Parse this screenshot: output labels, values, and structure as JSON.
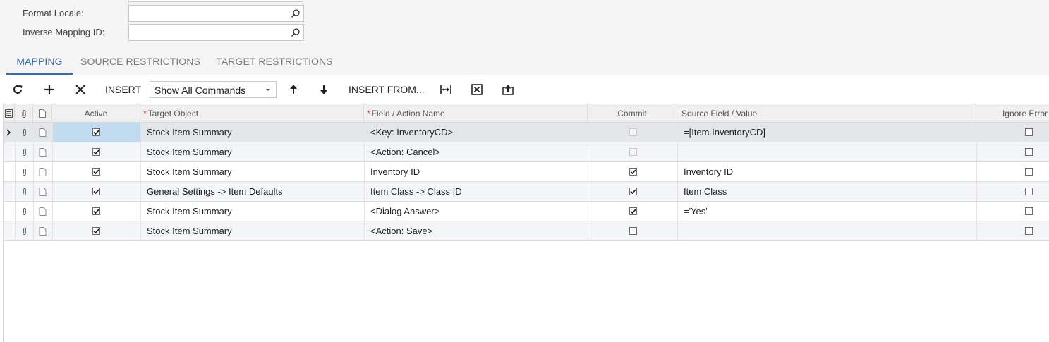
{
  "form": {
    "format_locale_label": "Format Locale:",
    "format_locale_value": "",
    "inverse_mapping_label": "Inverse Mapping ID:",
    "inverse_mapping_value": ""
  },
  "tabs": [
    {
      "label": "MAPPING",
      "active": true
    },
    {
      "label": "SOURCE RESTRICTIONS",
      "active": false
    },
    {
      "label": "TARGET RESTRICTIONS",
      "active": false
    }
  ],
  "toolbar": {
    "refresh_icon": "refresh-icon",
    "add_icon": "plus-icon",
    "delete_icon": "close-icon",
    "insert_label": "INSERT",
    "commands_select_value": "Show All Commands",
    "move_up_icon": "arrow-up-icon",
    "move_down_icon": "arrow-down-icon",
    "insert_from_label": "INSERT FROM...",
    "fit_columns_icon": "fit-width-icon",
    "export_excel_icon": "excel-icon",
    "upload_icon": "upload-icon"
  },
  "grid": {
    "columns": {
      "active": "Active",
      "target_object": "Target Object",
      "field_action": "Field / Action Name",
      "commit": "Commit",
      "source_field": "Source Field / Value",
      "ignore_error": "Ignore Error"
    },
    "rows": [
      {
        "active": true,
        "target_object": "Stock Item Summary",
        "field_action": "<Key: InventoryCD>",
        "commit": false,
        "commit_disabled": true,
        "source_field": "=[Item.InventoryCD]",
        "ignore_error": false,
        "current": true
      },
      {
        "active": true,
        "target_object": "Stock Item Summary",
        "field_action": "<Action: Cancel>",
        "commit": false,
        "commit_disabled": true,
        "source_field": "",
        "ignore_error": false,
        "current": false
      },
      {
        "active": true,
        "target_object": "Stock Item Summary",
        "field_action": "Inventory ID",
        "commit": true,
        "commit_disabled": false,
        "source_field": "Inventory ID",
        "ignore_error": false,
        "current": false
      },
      {
        "active": true,
        "target_object": "General Settings -> Item Defaults",
        "field_action": "Item Class -> Class ID",
        "commit": true,
        "commit_disabled": false,
        "source_field": "Item Class",
        "ignore_error": false,
        "current": false
      },
      {
        "active": true,
        "target_object": "Stock Item Summary",
        "field_action": "<Dialog Answer>",
        "commit": true,
        "commit_disabled": false,
        "source_field": "='Yes'",
        "ignore_error": false,
        "current": false
      },
      {
        "active": true,
        "target_object": "Stock Item Summary",
        "field_action": "<Action: Save>",
        "commit": false,
        "commit_disabled": false,
        "source_field": "",
        "ignore_error": false,
        "current": false
      }
    ]
  },
  "colors": {
    "accent": "#2f6fb5",
    "selected_cell": "#c3dbf1",
    "required_marker": "#d03b3b"
  }
}
